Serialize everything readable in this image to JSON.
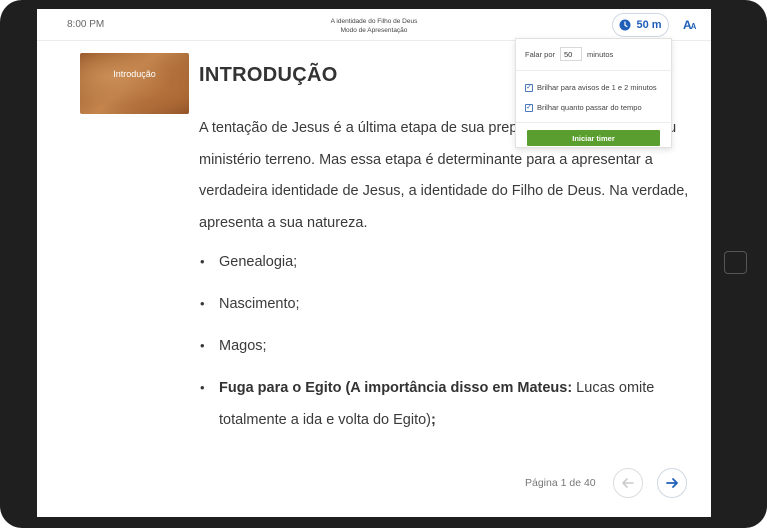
{
  "header": {
    "time": "8:00 PM",
    "document_title": "A identidade do Filho de Deus",
    "mode": "Modo de Apresentação",
    "timer_label": "50 m",
    "font_size_icon": "text-size-icon"
  },
  "timer_popover": {
    "talk_prefix": "Falar por",
    "minutes_value": "50",
    "minutes_suffix": "minutos",
    "option_warn": "Brilhar para avisos de 1 e 2 minutos",
    "option_overtime": "Brilhar quanto passar do tempo",
    "start_button": "Iniciar timer",
    "option_warn_checked": true,
    "option_overtime_checked": true
  },
  "slide": {
    "thumbnail_label": "Introdução",
    "heading": "INTRODUÇÃO",
    "paragraph": "A tentação de Jesus é a última etapa de sua preparação para iniciar o seu ministério terreno. Mas essa etapa é determinante para a apresentar a verdadeira identidade de Jesus, a identidade do Filho de Deus. Na verdade, apresenta a sua natureza.",
    "bullets": {
      "b1": "Genealogia;",
      "b2": "Nascimento;",
      "b3": "Magos;",
      "b4_bold": "Fuga para o Egito (A importância disso em Mateus:",
      "b4_regular": " Lucas omite totalmente a ida e volta do Egito)",
      "b4_end": ";"
    }
  },
  "footer": {
    "page_indicator": "Página 1 de 40"
  },
  "colors": {
    "accent": "#1f5fb8",
    "start_button": "#5a9e2f",
    "device_frame": "#1f1f1f"
  }
}
